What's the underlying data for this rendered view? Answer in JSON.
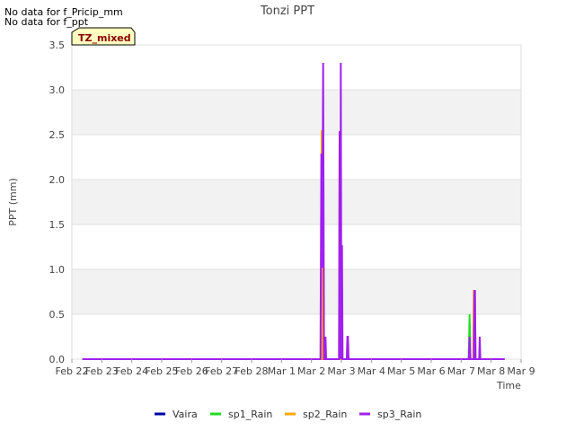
{
  "notes": [
    "No data for f_Pricip_mm",
    "No data for f_ppt"
  ],
  "badge": "TZ_mixed",
  "chart_data": {
    "type": "line",
    "title": "Tonzi PPT",
    "xlabel": "Time",
    "ylabel": "PPT (mm)",
    "x_tick_labels": [
      "Feb 22",
      "Feb 23",
      "Feb 24",
      "Feb 25",
      "Feb 26",
      "Feb 27",
      "Feb 28",
      "Mar 1",
      "Mar 2",
      "Mar 3",
      "Mar 4",
      "Mar 5",
      "Mar 6",
      "Mar 7",
      "Mar 8",
      "Mar 9"
    ],
    "y_tick_labels": [
      "0.0",
      "0.5",
      "1.0",
      "1.5",
      "2.0",
      "2.5",
      "3.0",
      "3.5"
    ],
    "ylim": [
      0,
      3.5
    ],
    "xlim_days": [
      0,
      15
    ],
    "grid": true,
    "legend_position": "bottom",
    "series": [
      {
        "name": "Vaira",
        "color": "#0000aa",
        "points": [
          [
            0.35,
            0
          ],
          [
            14.45,
            0
          ]
        ]
      },
      {
        "name": "sp1_Rain",
        "color": "#22dd22",
        "points": [
          [
            0.35,
            0
          ],
          [
            13.25,
            0
          ],
          [
            13.28,
            0.5
          ],
          [
            13.31,
            0
          ],
          [
            14.45,
            0
          ]
        ]
      },
      {
        "name": "sp2_Rain",
        "color": "#ffa500",
        "points": [
          [
            0.35,
            0
          ],
          [
            8.32,
            0
          ],
          [
            8.34,
            2.54
          ],
          [
            8.36,
            2.54
          ],
          [
            8.38,
            0
          ],
          [
            8.92,
            0
          ],
          [
            8.94,
            2.54
          ],
          [
            8.96,
            0
          ],
          [
            9.18,
            0
          ],
          [
            9.2,
            0.25
          ],
          [
            9.22,
            0
          ],
          [
            13.4,
            0
          ],
          [
            13.42,
            0.76
          ],
          [
            13.46,
            0.76
          ],
          [
            13.48,
            0
          ],
          [
            14.45,
            0
          ]
        ]
      },
      {
        "name": "sp3_Rain",
        "color": "#a020f0",
        "points": [
          [
            0.35,
            0
          ],
          [
            8.3,
            0
          ],
          [
            8.33,
            2.29
          ],
          [
            8.36,
            1.02
          ],
          [
            8.39,
            3.3
          ],
          [
            8.42,
            0
          ],
          [
            8.45,
            0
          ],
          [
            8.47,
            0.25
          ],
          [
            8.49,
            0
          ],
          [
            8.92,
            0
          ],
          [
            8.94,
            2.54
          ],
          [
            8.96,
            0
          ],
          [
            8.98,
            3.3
          ],
          [
            9.0,
            0
          ],
          [
            9.02,
            1.27
          ],
          [
            9.04,
            0
          ],
          [
            9.18,
            0
          ],
          [
            9.2,
            0.25
          ],
          [
            9.22,
            0.25
          ],
          [
            9.24,
            0
          ],
          [
            13.25,
            0
          ],
          [
            13.28,
            0.25
          ],
          [
            13.31,
            0
          ],
          [
            13.42,
            0
          ],
          [
            13.44,
            0.76
          ],
          [
            13.46,
            0.76
          ],
          [
            13.48,
            0
          ],
          [
            13.6,
            0
          ],
          [
            13.62,
            0.25
          ],
          [
            13.64,
            0
          ],
          [
            14.45,
            0
          ]
        ]
      }
    ]
  }
}
